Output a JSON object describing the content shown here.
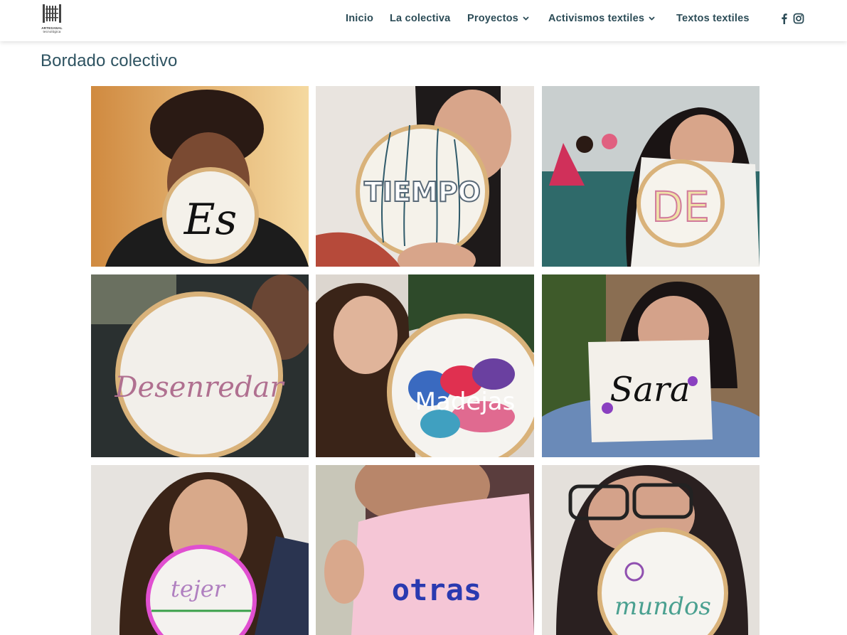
{
  "header": {
    "logo": {
      "line1": "ARTESANAL",
      "line2": "tecnológica",
      "icon": "loom-logo-icon"
    },
    "nav": [
      {
        "label": "Inicio",
        "has_dropdown": false
      },
      {
        "label": "La colectiva",
        "has_dropdown": false
      },
      {
        "label": "Proyectos",
        "has_dropdown": true
      },
      {
        "label": "Activismos textiles",
        "has_dropdown": true
      },
      {
        "label": "Textos textiles",
        "has_dropdown": false
      }
    ],
    "social": [
      {
        "name": "facebook",
        "icon": "facebook-icon"
      },
      {
        "name": "instagram",
        "icon": "instagram-icon"
      }
    ]
  },
  "page": {
    "title": "Bordado colectivo"
  },
  "gallery": {
    "items": [
      {
        "word": "Es",
        "hoop_color": "#d9b27a",
        "bg": "#e8a95a",
        "thread": "#111111"
      },
      {
        "word": "TIEMPO",
        "hoop_color": "#d9b27a",
        "bg": "#f2f0ee",
        "thread": "#5a6a78"
      },
      {
        "word": "DE",
        "hoop_color": "#d9b27a",
        "bg": "#3a6a6a",
        "thread": "#e9c88a"
      },
      {
        "word": "Desenredar",
        "hoop_color": "#d9b27a",
        "bg": "#2f3a3a",
        "thread": "#b07090"
      },
      {
        "word": "Madejas",
        "hoop_color": "#d9b27a",
        "bg": "#d8d2cc",
        "thread": "#ffffff"
      },
      {
        "word": "Sara",
        "hoop_color": "#f1f0ea",
        "bg": "#8a6e52",
        "thread": "#111111"
      },
      {
        "word": "tejer",
        "hoop_color": "#e04fd0",
        "bg": "#e9e6e3",
        "thread": "#b080c0"
      },
      {
        "word": "otras",
        "hoop_color": "#f5c6d6",
        "bg": "#5a3d3d",
        "thread": "#2a3ab0"
      },
      {
        "word": "mundos",
        "hoop_color": "#d9b27a",
        "bg": "#e7e2dd",
        "thread": "#4aa090"
      }
    ]
  }
}
